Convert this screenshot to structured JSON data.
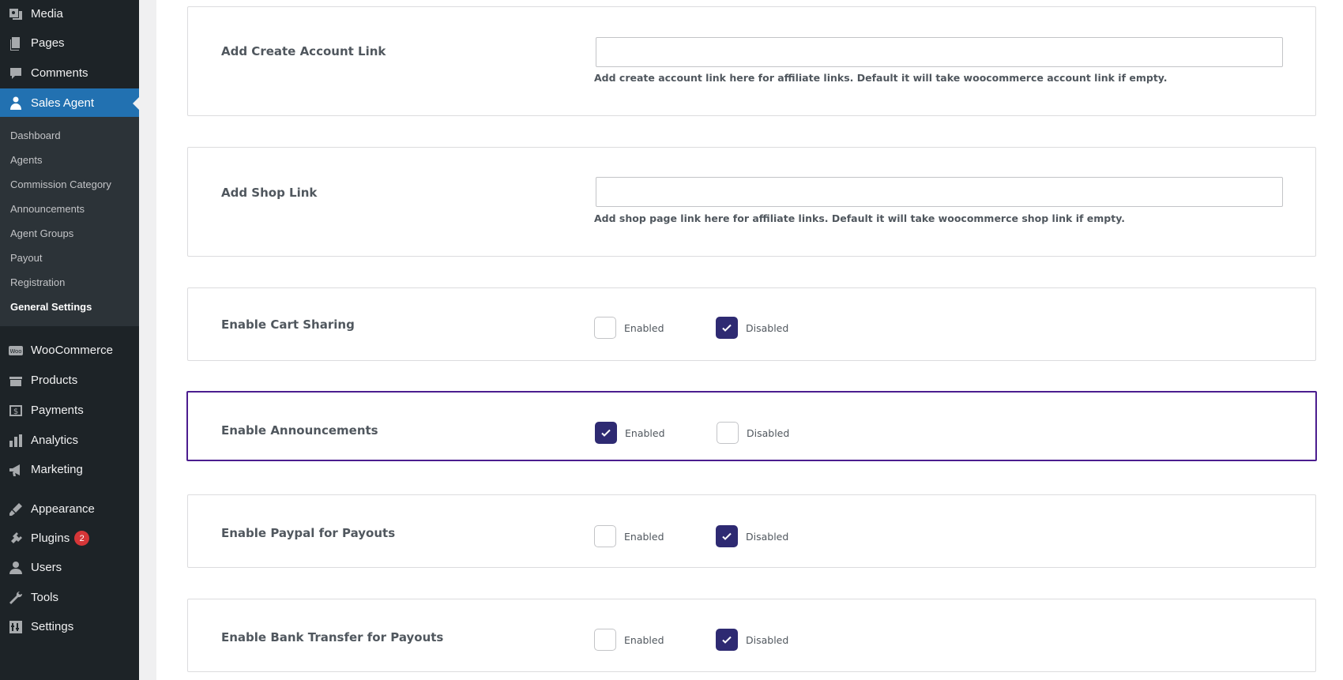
{
  "sidebar": {
    "top_items": [
      {
        "label": "Media",
        "icon": "media-icon"
      },
      {
        "label": "Pages",
        "icon": "pages-icon"
      },
      {
        "label": "Comments",
        "icon": "comments-icon"
      },
      {
        "label": "Sales Agent",
        "icon": "user-group-icon"
      }
    ],
    "submenu": [
      {
        "label": "Dashboard"
      },
      {
        "label": "Agents"
      },
      {
        "label": "Commission Category"
      },
      {
        "label": "Announcements"
      },
      {
        "label": "Agent Groups"
      },
      {
        "label": "Payout"
      },
      {
        "label": "Registration"
      },
      {
        "label": "General Settings"
      }
    ],
    "bottom_items": [
      {
        "label": "WooCommerce",
        "icon": "woocommerce-icon"
      },
      {
        "label": "Products",
        "icon": "products-icon"
      },
      {
        "label": "Payments",
        "icon": "payments-icon"
      },
      {
        "label": "Analytics",
        "icon": "analytics-icon"
      },
      {
        "label": "Marketing",
        "icon": "marketing-icon"
      },
      {
        "label": "Appearance",
        "icon": "appearance-icon"
      },
      {
        "label": "Plugins",
        "icon": "plugins-icon",
        "badge": "2"
      },
      {
        "label": "Users",
        "icon": "users-icon"
      },
      {
        "label": "Tools",
        "icon": "tools-icon"
      },
      {
        "label": "Settings",
        "icon": "settings-icon"
      }
    ],
    "active_item": "Sales Agent",
    "current_submenu": "General Settings",
    "accent_color": "#2271b1"
  },
  "settings": {
    "create_account_link": {
      "label": "Add Create Account Link",
      "value": "",
      "help": "Add create account link here for affiliate links. Default it will take woocommerce account link if empty."
    },
    "shop_link": {
      "label": "Add Shop Link",
      "value": "",
      "help": "Add shop page link here for affiliate links. Default it will take woocommerce shop link if empty."
    },
    "toggles": [
      {
        "label": "Enable Cart Sharing",
        "enabled_label": "Enabled",
        "disabled_label": "Disabled",
        "selected": "Disabled"
      },
      {
        "label": "Enable Announcements",
        "enabled_label": "Enabled",
        "disabled_label": "Disabled",
        "selected": "Enabled"
      },
      {
        "label": "Enable Paypal for Payouts",
        "enabled_label": "Enabled",
        "disabled_label": "Disabled",
        "selected": "Disabled"
      },
      {
        "label": "Enable Bank Transfer for Payouts",
        "enabled_label": "Enabled",
        "disabled_label": "Disabled",
        "selected": "Disabled"
      }
    ],
    "checkbox_color": "#2e2a72",
    "focus_border_color": "#4b1d8f"
  }
}
